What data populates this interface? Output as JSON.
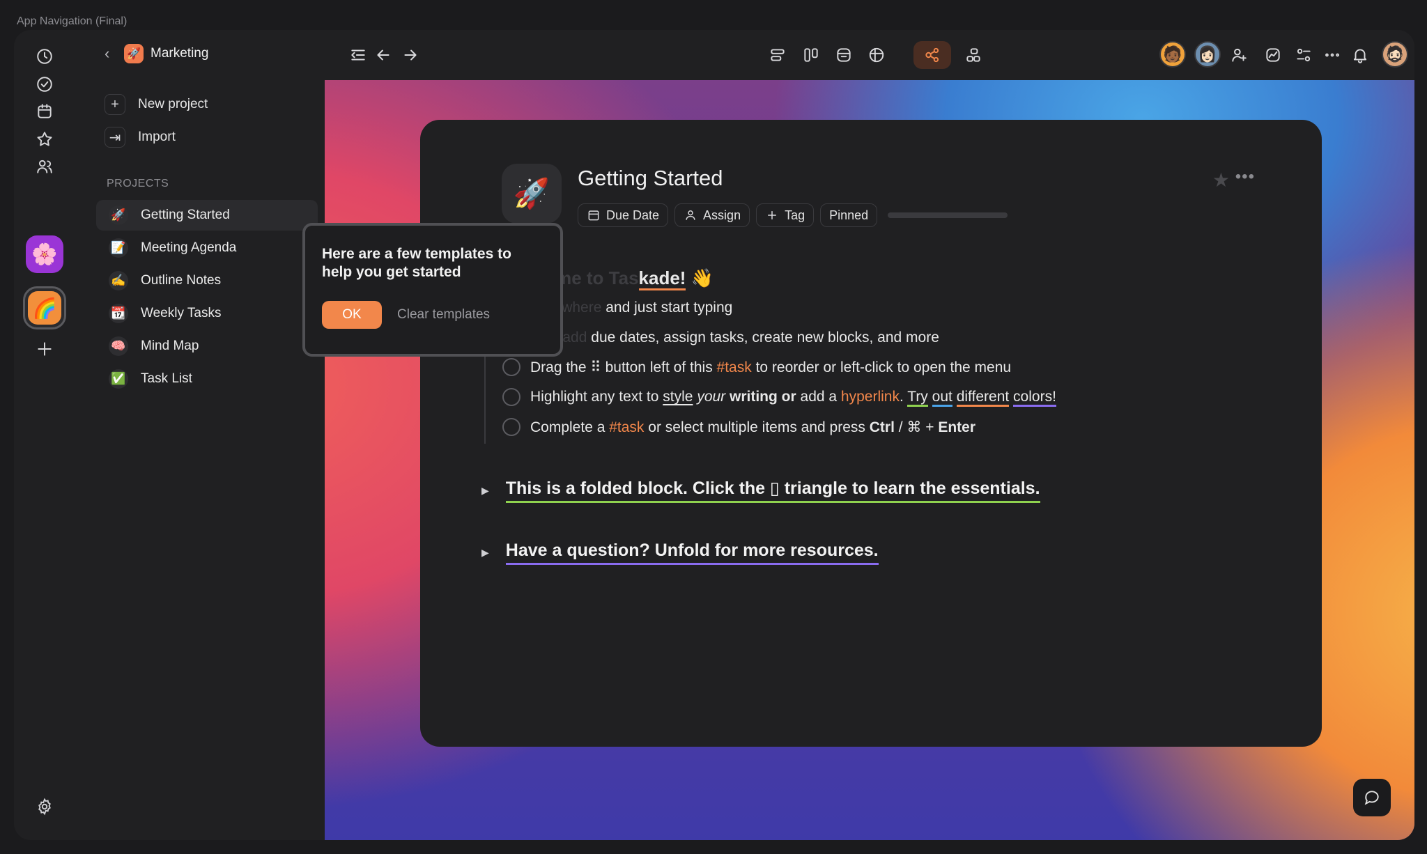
{
  "app_caption": "App Navigation (Final)",
  "workspace": {
    "name": "Marketing"
  },
  "sidebar": {
    "new_project": "New project",
    "import": "Import",
    "section_label": "PROJECTS",
    "projects": [
      {
        "label": "Getting Started",
        "emoji": "🚀"
      },
      {
        "label": "Meeting Agenda",
        "emoji": "📝"
      },
      {
        "label": "Outline Notes",
        "emoji": "✍️"
      },
      {
        "label": "Weekly Tasks",
        "emoji": "📆"
      },
      {
        "label": "Mind Map",
        "emoji": "🧠"
      },
      {
        "label": "Task List",
        "emoji": "✅"
      }
    ]
  },
  "rail": {
    "workspace_tiles": [
      {
        "emoji": "🌸",
        "color": "#9a35d6"
      },
      {
        "emoji": "🌈",
        "color": "#f28f3b"
      }
    ]
  },
  "toolbar": {
    "active_view": "mind-map",
    "avatars": [
      "🧑🏾",
      "👩🏻"
    ],
    "user_avatar": "🧔🏻"
  },
  "document": {
    "title": "Getting Started",
    "icon": "🚀",
    "chips": {
      "due_date": "Due Date",
      "assign": "Assign",
      "tag": "Tag",
      "pinned": "Pinned"
    },
    "progress_fraction": 0.0,
    "heading_visible": "kade!",
    "heading_emoji": "👋",
    "line1_visible": "and just start typing",
    "line2_visible": "due dates, assign tasks, create new blocks, and more",
    "task3": {
      "pre": "Drag the ⠿ button left of this ",
      "tag": "#task",
      "post": " to reorder or left-click to open the menu"
    },
    "task4": {
      "pre": "Highlight any text to ",
      "style": "style",
      "your": "your",
      "writing": "writing or",
      "add": " add a ",
      "hyperlink": "hyperlink",
      "dot": ". ",
      "try": "Try",
      "out": "out",
      "different": "different",
      "colors": "colors!"
    },
    "task5": {
      "pre": "Complete a ",
      "tag": "#task",
      "mid": " or select multiple items and press ",
      "ctrl": "Ctrl",
      "slash": " / ⌘ + ",
      "enter": "Enter"
    },
    "fold1": "This is a folded block. Click the ▯ triangle to learn the essentials.",
    "fold2": "Have a question? Unfold for more resources."
  },
  "popover": {
    "message": "Here are a few templates to help you get started",
    "ok": "OK",
    "clear": "Clear templates"
  },
  "colors": {
    "accent": "#f2874b",
    "background": "#202022"
  }
}
